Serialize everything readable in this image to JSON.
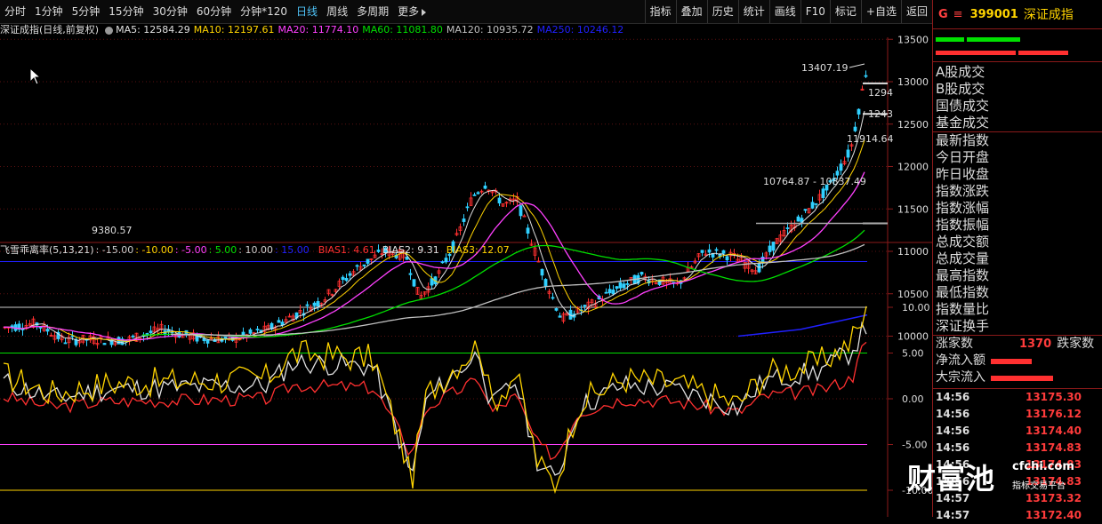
{
  "toolbar": {
    "left": [
      "分时",
      "1分钟",
      "5分钟",
      "15分钟",
      "30分钟",
      "60分钟",
      "分钟*120",
      "日线",
      "周线",
      "多周期",
      "更多"
    ],
    "active": "日线",
    "right": [
      "指标",
      "叠加",
      "历史",
      "统计",
      "画线",
      "F10",
      "标记",
      "+自选",
      "返回"
    ]
  },
  "title": "深证成指(日线,前复权)",
  "ma": [
    {
      "label": "MA5: 12584.29",
      "color": "#e0e0e0"
    },
    {
      "label": "MA10: 12197.61",
      "color": "#ffd400"
    },
    {
      "label": "MA20: 11774.10",
      "color": "#ff40ff"
    },
    {
      "label": "MA60: 11081.80",
      "color": "#00e000"
    },
    {
      "label": "MA120: 10935.72",
      "color": "#c0c0c0"
    },
    {
      "label": "MA250: 10246.12",
      "color": "#2020ff"
    }
  ],
  "price_axis": [
    "13500",
    "13000",
    "12500",
    "12000",
    "11500",
    "11000",
    "10500",
    "10000"
  ],
  "price_annotations": [
    "13407.19",
    "9380.57",
    "10764.87 - 10837.49",
    "11914.64",
    "1243",
    "1294"
  ],
  "indicator": {
    "name": "飞雪乖离率(5,13,21)",
    "levels": [
      {
        "label": ": -15.00",
        "color": "#cccccc"
      },
      {
        "label": ": -10.00",
        "color": "#ffd400"
      },
      {
        "label": ": -5.00",
        "color": "#ff40ff"
      },
      {
        "label": ": 5.00",
        "color": "#00e000"
      },
      {
        "label": ": 10.00",
        "color": "#cccccc"
      },
      {
        "label": ": 15.00",
        "color": "#2020ff"
      }
    ],
    "bias": [
      {
        "label": "BIAS1: 4.61",
        "color": "#ff3030"
      },
      {
        "label": "BIAS2: 9.31",
        "color": "#e0e0e0"
      },
      {
        "label": "BIAS3: 12.07",
        "color": "#ffd400"
      }
    ],
    "axis": [
      "10.00",
      "5.00",
      "0.00",
      "-5.00",
      "-10.00"
    ]
  },
  "panel": {
    "g": "G",
    "menu": "≡",
    "code": "399001",
    "name": "深证成指",
    "items_a": [
      "A股成交",
      "B股成交",
      "国债成交",
      "基金成交"
    ],
    "items_b": [
      "最新指数",
      "今日开盘",
      "昨日收盘",
      "指数涨跌",
      "指数涨幅",
      "指数振幅",
      "总成交额",
      "总成交量",
      "最高指数",
      "最低指数",
      "指数量比",
      "深证换手"
    ],
    "adv_label": "涨家数",
    "adv_value": "1370",
    "dec_label": "跌家数",
    "flows": [
      "净流入额",
      "大宗流入"
    ],
    "ticks": [
      {
        "t": "14:56",
        "p": "13175.30"
      },
      {
        "t": "14:56",
        "p": "13176.12"
      },
      {
        "t": "14:56",
        "p": "13174.40"
      },
      {
        "t": "14:56",
        "p": "13174.83"
      },
      {
        "t": "14:56",
        "p": "13174.83"
      },
      {
        "t": "14:56",
        "p": "13174.83"
      },
      {
        "t": "14:57",
        "p": "13173.32"
      },
      {
        "t": "14:57",
        "p": "13172.40"
      }
    ]
  },
  "watermark": {
    "main": "财富池",
    "site": "cfchi.com",
    "slogan": "指标交易平台"
  }
}
